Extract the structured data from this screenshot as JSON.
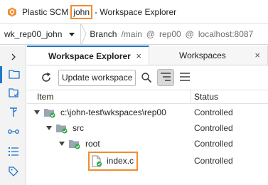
{
  "window": {
    "app_name": "Plastic SCM",
    "user": "john",
    "title_suffix": "- Workspace Explorer"
  },
  "workspace_bar": {
    "workspace": "wk_rep00_john",
    "branch_label": "Branch",
    "branch": "/main",
    "at1": "@",
    "repo": "rep00",
    "at2": "@",
    "server": "localhost:8087"
  },
  "sidebar": {
    "items": [
      {
        "icon": "chevron-right-icon"
      },
      {
        "icon": "folder-icon"
      },
      {
        "icon": "pending-changes-icon"
      },
      {
        "icon": "branches-icon"
      },
      {
        "icon": "changesets-icon"
      },
      {
        "icon": "list-icon"
      },
      {
        "icon": "labels-icon"
      }
    ]
  },
  "tabs": [
    {
      "label": "Workspace Explorer",
      "close": "×",
      "active": true
    },
    {
      "label": "Workspaces",
      "close": "×",
      "active": false
    }
  ],
  "toolbar": {
    "update_label": "Update workspace"
  },
  "table": {
    "columns": {
      "item": "Item",
      "status": "Status"
    },
    "rows": [
      {
        "name": "c:\\john-test\\wkspaces\\rep00",
        "status": "Controlled"
      },
      {
        "name": "src",
        "status": "Controlled"
      },
      {
        "name": "root",
        "status": "Controlled"
      },
      {
        "name": "index.c",
        "status": "Controlled"
      }
    ]
  },
  "colors": {
    "accent": "#1f77c9",
    "highlight": "#f08c30",
    "checked": "#2eaa4a"
  }
}
